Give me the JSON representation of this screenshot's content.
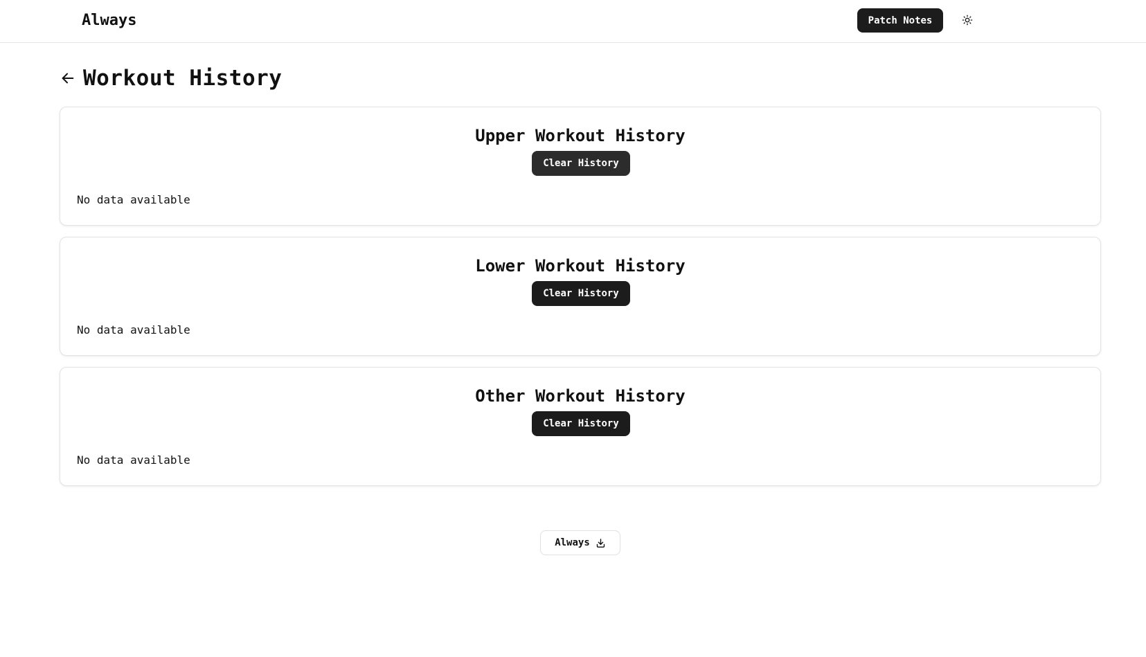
{
  "header": {
    "brand": "Always",
    "patch_notes_label": "Patch Notes",
    "theme_icon": "sun-icon"
  },
  "page": {
    "title": "Workout History",
    "back_icon": "arrow-left-icon"
  },
  "sections": [
    {
      "title": "Upper Workout History",
      "clear_label": "Clear History",
      "empty_text": "No data available"
    },
    {
      "title": "Lower Workout History",
      "clear_label": "Clear History",
      "empty_text": "No data available"
    },
    {
      "title": "Other Workout History",
      "clear_label": "Clear History",
      "empty_text": "No data available"
    }
  ],
  "footer": {
    "install_label": "Always",
    "install_icon": "download-icon"
  },
  "colors": {
    "button_dark": "#1c1c1c",
    "border": "#e3e3e3",
    "text": "#111111",
    "background": "#ffffff"
  }
}
